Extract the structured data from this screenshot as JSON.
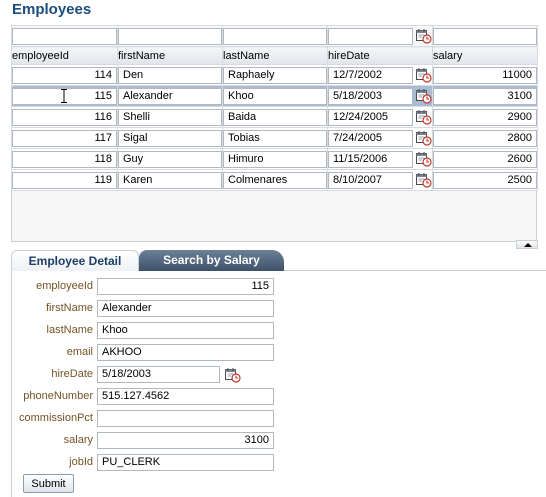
{
  "page": {
    "title": "Employees"
  },
  "table": {
    "columns": [
      {
        "key": "employeeId",
        "label": "employeeId",
        "align": "right"
      },
      {
        "key": "firstName",
        "label": "firstName",
        "align": "left"
      },
      {
        "key": "lastName",
        "label": "lastName",
        "align": "left"
      },
      {
        "key": "hireDate",
        "label": "hireDate",
        "align": "left"
      },
      {
        "key": "salary",
        "label": "salary",
        "align": "right"
      }
    ],
    "filters": {
      "employeeId": "",
      "firstName": "",
      "lastName": "",
      "hireDate": "",
      "salary": ""
    },
    "selected_index": 1,
    "rows": [
      {
        "employeeId": "114",
        "firstName": "Den",
        "lastName": "Raphaely",
        "hireDate": "12/7/2002",
        "salary": "11000"
      },
      {
        "employeeId": "115",
        "firstName": "Alexander",
        "lastName": "Khoo",
        "hireDate": "5/18/2003",
        "salary": "3100"
      },
      {
        "employeeId": "116",
        "firstName": "Shelli",
        "lastName": "Baida",
        "hireDate": "12/24/2005",
        "salary": "2900"
      },
      {
        "employeeId": "117",
        "firstName": "Sigal",
        "lastName": "Tobias",
        "hireDate": "7/24/2005",
        "salary": "2800"
      },
      {
        "employeeId": "118",
        "firstName": "Guy",
        "lastName": "Himuro",
        "hireDate": "11/15/2006",
        "salary": "2600"
      },
      {
        "employeeId": "119",
        "firstName": "Karen",
        "lastName": "Colmenares",
        "hireDate": "8/10/2007",
        "salary": "2500"
      }
    ]
  },
  "tabs": [
    {
      "label": "Employee Detail",
      "active": true
    },
    {
      "label": "Search by Salary",
      "active": false
    }
  ],
  "detail_form": {
    "fields": [
      {
        "label": "employeeId",
        "value": "115",
        "align": "right",
        "type": "text"
      },
      {
        "label": "firstName",
        "value": "Alexander",
        "align": "left",
        "type": "text"
      },
      {
        "label": "lastName",
        "value": "Khoo",
        "align": "left",
        "type": "text"
      },
      {
        "label": "email",
        "value": "AKHOO",
        "align": "left",
        "type": "text"
      },
      {
        "label": "hireDate",
        "value": "5/18/2003",
        "align": "left",
        "type": "date"
      },
      {
        "label": "phoneNumber",
        "value": "515.127.4562",
        "align": "left",
        "type": "text"
      },
      {
        "label": "commissionPct",
        "value": "",
        "align": "left",
        "type": "text"
      },
      {
        "label": "salary",
        "value": "3100",
        "align": "right",
        "type": "text"
      },
      {
        "label": "jobId",
        "value": "PU_CLERK",
        "align": "left",
        "type": "text"
      }
    ],
    "submit_label": "Submit"
  },
  "icons": {
    "date_picker": "calendar-clock-icon",
    "scroll_up": "triangle-up-icon",
    "cursor": "text-cursor-icon"
  },
  "colors": {
    "title": "#1d4d7c",
    "label": "#745324",
    "selected_row": "#a9bcd4",
    "inactive_tab": "#4f647b"
  }
}
